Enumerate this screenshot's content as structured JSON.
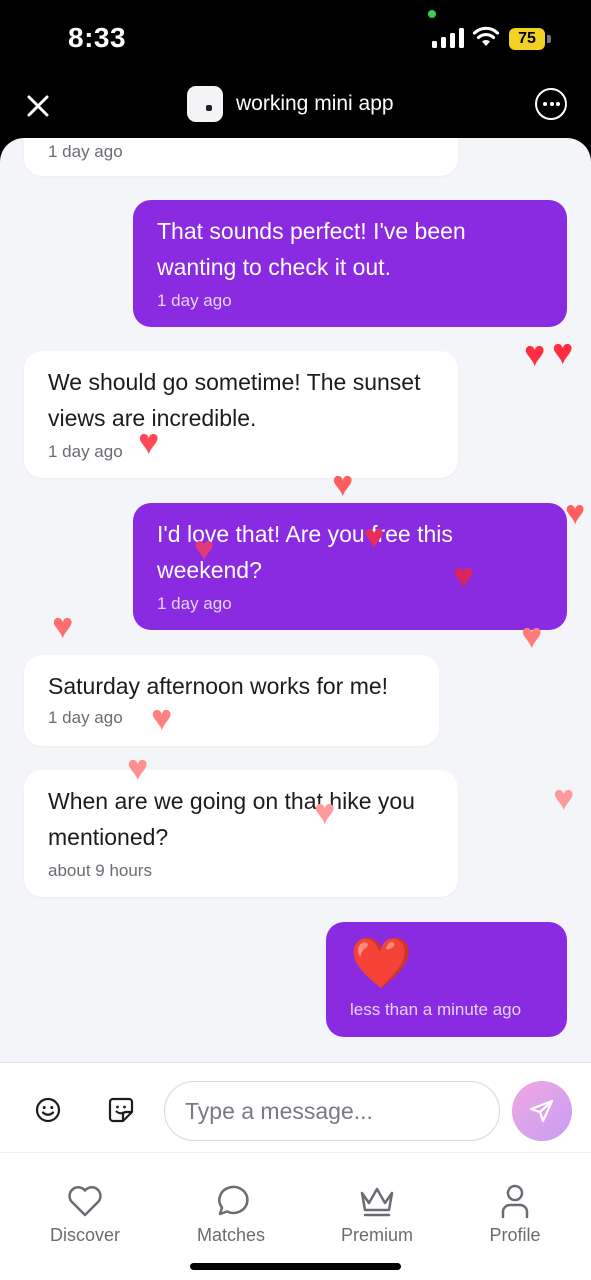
{
  "status_bar": {
    "time": "8:33",
    "battery": "75"
  },
  "header": {
    "app_title": "working mini app"
  },
  "messages": [
    {
      "direction": "in",
      "text": "",
      "time": "1 day ago"
    },
    {
      "direction": "out",
      "text": "That sounds perfect! I've been wanting to check it out.",
      "time": "1 day ago"
    },
    {
      "direction": "in",
      "text": "We should go sometime! The sunset views are incredible.",
      "time": "1 day ago"
    },
    {
      "direction": "out",
      "text": "I'd love that! Are you free this weekend?",
      "time": "1 day ago"
    },
    {
      "direction": "in",
      "text": "Saturday afternoon works for me!",
      "time": "1 day ago"
    },
    {
      "direction": "in",
      "text": "When are we going on that hike you mentioned?",
      "time": "about 9 hours"
    },
    {
      "direction": "out",
      "text": "❤️",
      "time": "less than a minute ago"
    }
  ],
  "input": {
    "placeholder": "Type a message..."
  },
  "nav": [
    {
      "label": "Discover",
      "icon": "heart-outline-icon"
    },
    {
      "label": "Matches",
      "icon": "chat-bubble-icon"
    },
    {
      "label": "Premium",
      "icon": "crown-icon"
    },
    {
      "label": "Profile",
      "icon": "person-icon"
    }
  ],
  "colors": {
    "outgoing_bubble": "#8a2be2",
    "incoming_bubble": "#ffffff",
    "chat_background": "#f4f5f9",
    "heart": "#ff3b4a"
  }
}
